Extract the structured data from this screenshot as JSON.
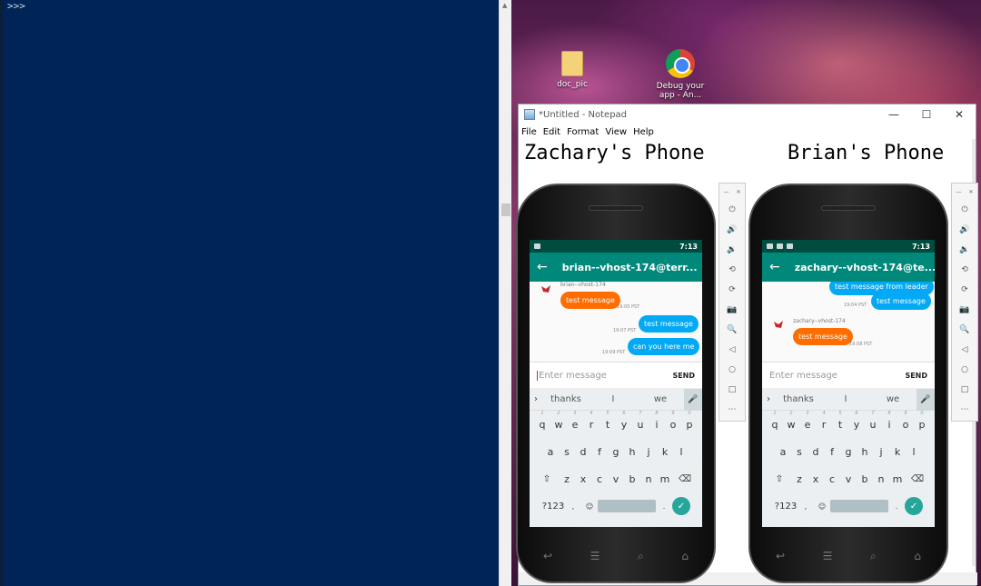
{
  "terminal": {
    "prompt": ">>>"
  },
  "desktop": {
    "icons": [
      {
        "name": "folder",
        "label": "doc_pic"
      },
      {
        "name": "chrome",
        "label": "Debug your app - An..."
      }
    ]
  },
  "notepad": {
    "window_title": "*Untitled - Notepad",
    "menu": [
      "File",
      "Edit",
      "Format",
      "View",
      "Help"
    ],
    "controls": {
      "minimize": "—",
      "maximize": "☐",
      "close": "✕"
    },
    "heading_left": "Zachary's Phone",
    "heading_right": "Brian's Phone"
  },
  "phones": [
    {
      "status_time": "7:13",
      "chat_title": "brian--vhost-174@terr...",
      "messages": [
        {
          "sender": "brian--vhost-174",
          "text": "test message",
          "time": "19:05 PST",
          "color": "orange"
        },
        {
          "text": "test message",
          "time": "19:07 PST",
          "color": "blue"
        },
        {
          "text": "can you here me",
          "time": "19:09 PST",
          "color": "blue"
        }
      ],
      "input_placeholder": "Enter message",
      "send_label": "SEND",
      "suggestions": [
        "thanks",
        "I",
        "we"
      ]
    },
    {
      "status_time": "7:13",
      "chat_title": "zachary--vhost-174@te...",
      "messages": [
        {
          "text": "test message from leader",
          "time": "19:04 PST",
          "color": "blue"
        },
        {
          "text": "test message",
          "color": "blue"
        },
        {
          "sender": "zachary--vhost-174",
          "text": "test message",
          "time": "19:08 PST",
          "color": "orange"
        }
      ],
      "input_placeholder": "Enter message",
      "send_label": "SEND",
      "suggestions": [
        "thanks",
        "I",
        "we"
      ]
    }
  ],
  "keyboard": {
    "row1": [
      "q",
      "w",
      "e",
      "r",
      "t",
      "y",
      "u",
      "i",
      "o",
      "p"
    ],
    "row1_hints": [
      "1",
      "2",
      "3",
      "4",
      "5",
      "6",
      "7",
      "8",
      "9",
      "0"
    ],
    "row2": [
      "a",
      "s",
      "d",
      "f",
      "g",
      "h",
      "j",
      "k",
      "l"
    ],
    "row3": [
      "z",
      "x",
      "c",
      "v",
      "b",
      "n",
      "m"
    ],
    "symbols_key": "?123",
    "comma": ",",
    "period": "."
  },
  "emulator_toolbar": [
    "power-icon",
    "volume-up-icon",
    "volume-down-icon",
    "rotate-left-icon",
    "rotate-right-icon",
    "camera-icon",
    "zoom-icon",
    "back-icon",
    "home-icon",
    "overview-icon",
    "more-icon"
  ]
}
